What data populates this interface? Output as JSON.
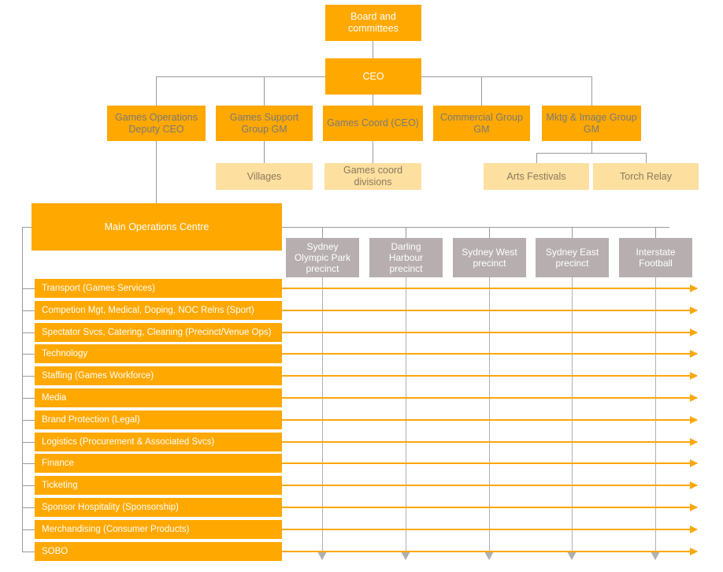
{
  "chart_data": {
    "type": "diagram",
    "title": "Sydney 2000 Olympic Games organisational structure",
    "diagram_type": "org-chart-with-matrix"
  },
  "colors": {
    "orange": "#FFA800",
    "light_orange": "#FDDFA0",
    "grey": "#B7AFAF",
    "arrow_orange": "#FBA70E",
    "connector_grey": "#9A9A9A",
    "white_text": "#FFFFFF",
    "grey_text": "#7A7A7A",
    "brown_text": "#8A7A5A"
  },
  "top": {
    "board": "Board and\ncommittees",
    "ceo": "CEO"
  },
  "divisions": [
    {
      "label": "Games Operations\nDeputy CEO"
    },
    {
      "label": "Games Support\nGroup GM"
    },
    {
      "label": "Games Coord (CEO)"
    },
    {
      "label": "Commercial Group\nGM"
    },
    {
      "label": "Mktg & Image Group\nGM"
    }
  ],
  "sub_units": [
    {
      "label": "Villages"
    },
    {
      "label": "Games coord\ndivisions"
    },
    {
      "label": "Arts Festivals"
    },
    {
      "label": "Torch Relay"
    }
  ],
  "operations_centre": {
    "label": "Main Operations Centre"
  },
  "precincts": [
    {
      "label": "Sydney\nOlympic Park\nprecinct"
    },
    {
      "label": "Darling\nHarbour\nprecinct"
    },
    {
      "label": "Sydney West\nprecinct"
    },
    {
      "label": "Sydney East\nprecinct"
    },
    {
      "label": "Interstate\nFootball"
    }
  ],
  "functions": [
    {
      "label": "Transport (Games Services)"
    },
    {
      "label": "Competion Mgt, Medical, Doping, NOC Relns (Sport)"
    },
    {
      "label": "Spectator Svcs, Catering, Cleaning (Precinct/Venue Ops)"
    },
    {
      "label": "Technology"
    },
    {
      "label": "Staffing (Games Workforce)"
    },
    {
      "label": "Media"
    },
    {
      "label": "Brand Protection (Legal)"
    },
    {
      "label": "Logistics (Procurement & Associated Svcs)"
    },
    {
      "label": "Finance"
    },
    {
      "label": "Ticketing"
    },
    {
      "label": "Sponsor Hospitality (Sponsorship)"
    },
    {
      "label": "Merchandising (Consumer Products)"
    },
    {
      "label": "SOBO"
    }
  ]
}
